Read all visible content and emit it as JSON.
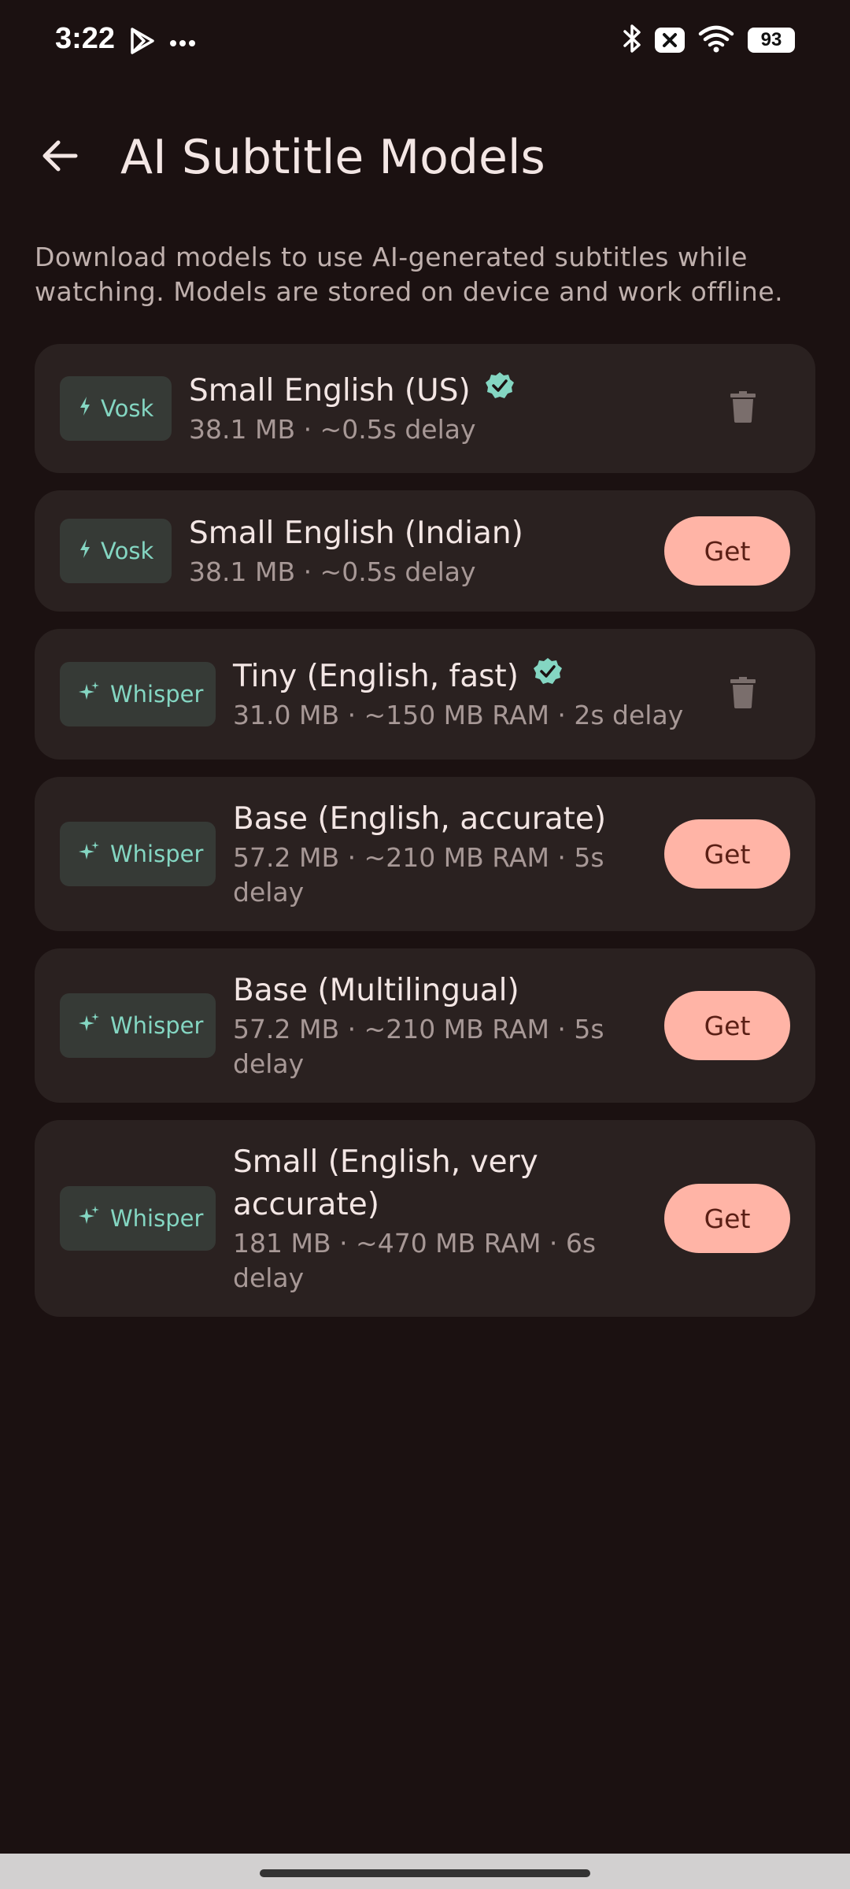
{
  "status_bar": {
    "time": "3:22",
    "battery": "93",
    "icons": [
      "play-store-icon",
      "more-dots-icon",
      "bluetooth-icon",
      "x-notification-icon",
      "wifi-icon",
      "battery-icon"
    ]
  },
  "header": {
    "title": "AI Subtitle Models",
    "back_icon": "arrow-back-icon"
  },
  "description": "Download models to use AI-generated subtitles while watching. Models are stored on device and work offline.",
  "colors": {
    "background": "#1b1111",
    "card": "#2a2120",
    "accent": "#ffb4a6",
    "chip_text": "#84d6c2",
    "verified": "#84d6c2"
  },
  "models": [
    {
      "engine": "Vosk",
      "engine_icon": "bolt-icon",
      "name": "Small English (US)",
      "meta": "38.1 MB · ~0.5s delay",
      "downloaded": true,
      "action": "delete-icon"
    },
    {
      "engine": "Vosk",
      "engine_icon": "bolt-icon",
      "name": "Small English (Indian)",
      "meta": "38.1 MB · ~0.5s delay",
      "downloaded": false,
      "action_label": "Get"
    },
    {
      "engine": "Whisper",
      "engine_icon": "sparkle-icon",
      "name": "Tiny (English, fast)",
      "meta": "31.0 MB · ~150 MB RAM · 2s delay",
      "downloaded": true,
      "action": "delete-icon"
    },
    {
      "engine": "Whisper",
      "engine_icon": "sparkle-icon",
      "name": "Base (English, accurate)",
      "meta": "57.2 MB · ~210 MB RAM · 5s delay",
      "downloaded": false,
      "action_label": "Get"
    },
    {
      "engine": "Whisper",
      "engine_icon": "sparkle-icon",
      "name": "Base (Multilingual)",
      "meta": "57.2 MB · ~210 MB RAM · 5s delay",
      "downloaded": false,
      "action_label": "Get"
    },
    {
      "engine": "Whisper",
      "engine_icon": "sparkle-icon",
      "name": "Small (English, very accurate)",
      "meta": "181 MB · ~470 MB RAM · 6s delay",
      "downloaded": false,
      "action_label": "Get"
    }
  ]
}
